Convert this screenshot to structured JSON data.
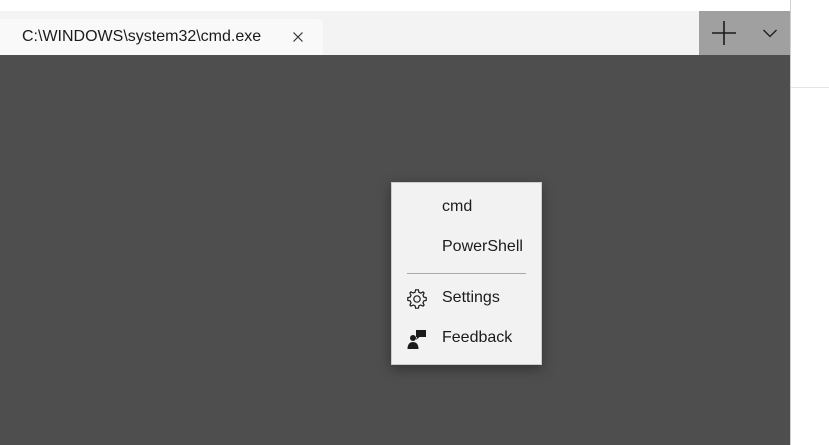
{
  "tab": {
    "title": "C:\\WINDOWS\\system32\\cmd.exe"
  },
  "menu": {
    "items": [
      {
        "label": "cmd",
        "icon": ""
      },
      {
        "label": "PowerShell",
        "icon": ""
      },
      {
        "label": "Settings",
        "icon": "gear-icon"
      },
      {
        "label": "Feedback",
        "icon": "feedback-icon"
      }
    ]
  },
  "icons": {
    "close": "close-icon",
    "new_tab": "plus-icon",
    "dropdown": "chevron-down-icon"
  },
  "colors": {
    "terminal_background": "#4d4e4d",
    "titlebar": "#f3f3f3",
    "active_tab": "#f9f9f9",
    "titlebar_buttons": "#a0a0a0",
    "menu_background": "#f2f2f2"
  }
}
